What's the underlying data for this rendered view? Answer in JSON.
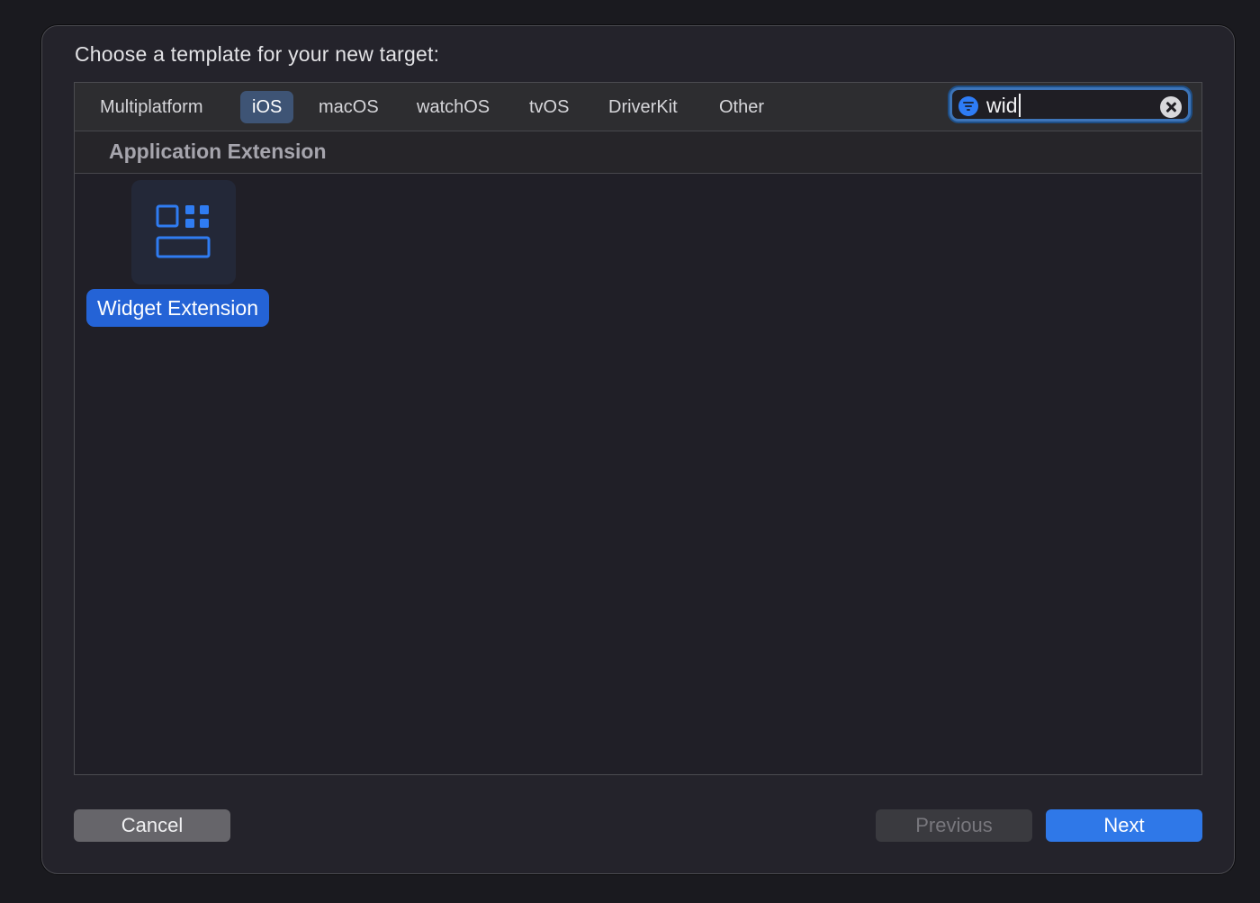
{
  "dialog": {
    "title": "Choose a template for your new target:"
  },
  "platform_tabs": {
    "selected": "iOS",
    "items": [
      {
        "label": "Multiplatform"
      },
      {
        "label": "iOS"
      },
      {
        "label": "macOS"
      },
      {
        "label": "watchOS"
      },
      {
        "label": "tvOS"
      },
      {
        "label": "DriverKit"
      },
      {
        "label": "Other"
      }
    ]
  },
  "search": {
    "value": "wid",
    "icon": "filter-icon",
    "clear_icon": "clear-icon"
  },
  "section": {
    "title": "Application Extension"
  },
  "templates": [
    {
      "label": "Widget Extension",
      "icon": "widget-icon",
      "selected": true
    }
  ],
  "buttons": {
    "cancel": "Cancel",
    "previous": "Previous",
    "next": "Next"
  },
  "colors": {
    "accent": "#2f78e8",
    "selection": "#2463d6",
    "icon_stroke": "#2f7cf2"
  }
}
